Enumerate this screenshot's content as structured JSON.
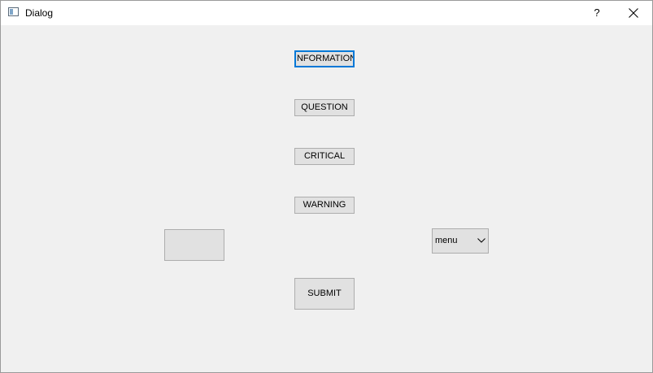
{
  "window": {
    "title": "Dialog",
    "help_label": "?"
  },
  "buttons": {
    "information": "INFORMATION",
    "question": "QUESTION",
    "critical": "CRITICAL",
    "warning": "WARNING",
    "submit": "SUBMIT",
    "blank": ""
  },
  "combo": {
    "selected": "menu"
  },
  "icons": {
    "window": "window-icon",
    "help": "help-icon",
    "close": "close-icon",
    "dropdown": "chevron-down-icon"
  },
  "colors": {
    "background": "#f0f0f0",
    "titlebar": "#ffffff",
    "button_face": "#e1e1e1",
    "button_border": "#adadad",
    "focus_border": "#0078d7"
  }
}
